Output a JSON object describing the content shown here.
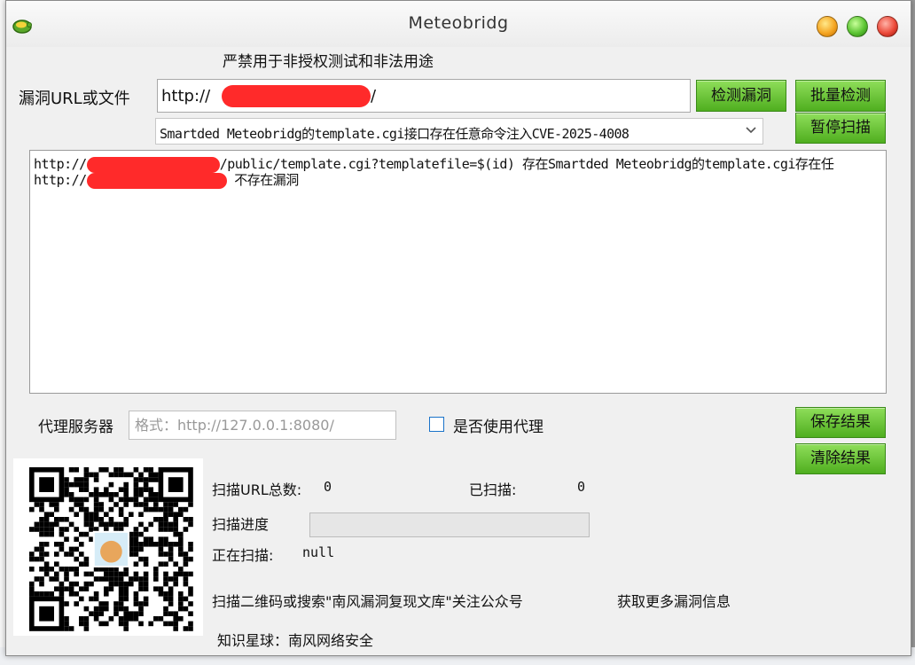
{
  "window": {
    "title": "Meteobridg"
  },
  "warning_text": "严禁用于非授权测试和非法用途",
  "url_section": {
    "label": "漏洞URL或文件",
    "value_prefix": "http://",
    "value_suffix": "/"
  },
  "buttons": {
    "detect": "检测漏洞",
    "batch": "批量检测",
    "pause": "暂停扫描",
    "save": "保存结果",
    "clear": "清除结果"
  },
  "vuln_select": {
    "selected": "Smartded Meteobridg的template.cgi接口存在任意命令注入CVE-2025-4008"
  },
  "output": {
    "lines": [
      {
        "prefix": "http://",
        "suffix": "/public/template.cgi?templatefile=$(id)  存在Smartded Meteobridg的template.cgi存在任"
      },
      {
        "prefix": "http://",
        "suffix": "  不存在漏洞"
      }
    ]
  },
  "proxy": {
    "label": "代理服务器",
    "placeholder": "格式：http://127.0.0.1:8080/",
    "use_proxy_label": "是否使用代理",
    "use_proxy_checked": false
  },
  "stats": {
    "total_label": "扫描URL总数:",
    "total_value": "0",
    "scanned_label": "已扫描:",
    "scanned_value": "0",
    "progress_label": "扫描进度",
    "progress": 0,
    "scanning_label": "正在扫描:",
    "scanning_value": "null"
  },
  "footer": {
    "qr_text": "扫描二维码或搜索\"南风漏洞复现文库\"关注公众号",
    "more_info": "获取更多漏洞信息",
    "planet": "知识星球：南风网络安全"
  },
  "colors": {
    "button_green": "#5cbf2a",
    "redaction_red": "#ff2a2a",
    "checkbox_border": "#1a73c9"
  },
  "icons": {
    "app": "turtle-icon",
    "minimize": "minimize-icon",
    "maximize": "maximize-icon",
    "close": "close-icon",
    "dropdown": "chevron-down-icon"
  }
}
